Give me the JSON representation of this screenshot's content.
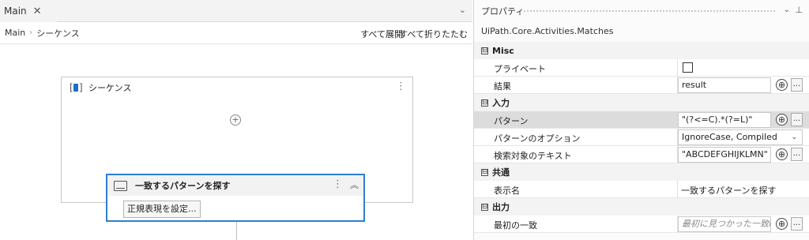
{
  "designer": {
    "tab": {
      "label": "Main",
      "close_glyph": "✕"
    },
    "tab_overflow_glyph": "⌄",
    "breadcrumb": {
      "root": "Main",
      "separator": "›",
      "current": "シーケンス"
    },
    "expand_all": "すべて展開",
    "collapse_all": "すべて折りたたむ",
    "sequence": {
      "title": "シーケンス",
      "menu_glyph": "⋮",
      "add_glyph": "+",
      "icon": "sequence-icon"
    },
    "activity": {
      "title": "一致するパターンを探す",
      "icon": "window-icon",
      "menu_glyph": "⋮",
      "collapse_glyph": "︽",
      "configure_button": "正規表現を設定..."
    }
  },
  "properties": {
    "title": "プロパティ",
    "dropdown_glyph": "⌄",
    "pin_glyph": "⊥",
    "type_name": "UiPath.Core.Activities.Matches",
    "plus_glyph": "⊕",
    "ellipsis": "...",
    "categories": [
      {
        "name": "Misc",
        "toggle": "⊟",
        "rows": [
          {
            "name": "プライベート",
            "kind": "checkbox",
            "checked": false
          },
          {
            "name": "結果",
            "kind": "input",
            "value": "result"
          }
        ]
      },
      {
        "name": "入力",
        "toggle": "⊟",
        "rows": [
          {
            "name": "パターン",
            "kind": "input",
            "value": "\"(?<=C).*(?=L)\"",
            "selected": true
          },
          {
            "name": "パターンのオプション",
            "kind": "select",
            "value": "IgnoreCase, Compiled",
            "chevron": "⌄"
          },
          {
            "name": "検索対象のテキスト",
            "kind": "input",
            "value": "\"ABCDEFGHIJKLMN\""
          }
        ]
      },
      {
        "name": "共通",
        "toggle": "⊟",
        "rows": [
          {
            "name": "表示名",
            "kind": "text",
            "value": "一致するパターンを探す"
          }
        ]
      },
      {
        "name": "出力",
        "toggle": "⊟",
        "rows": [
          {
            "name": "最初の一致",
            "kind": "input",
            "placeholder": "最初に見つかった一致i"
          }
        ]
      }
    ]
  }
}
